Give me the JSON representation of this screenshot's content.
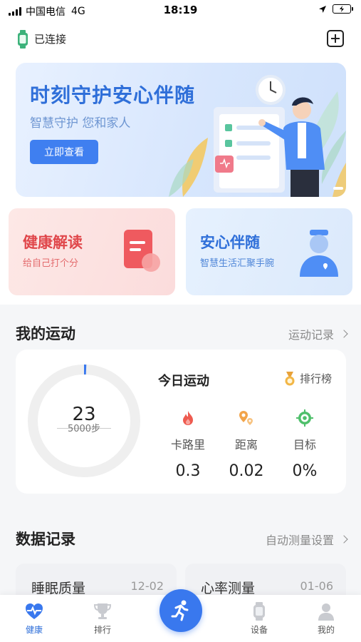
{
  "status_bar": {
    "carrier": "中国电信",
    "network": "4G",
    "time": "18:19"
  },
  "header": {
    "connection_status": "已连接"
  },
  "banner": {
    "title": "时刻守护安心伴随",
    "subtitle": "智慧守护 您和家人",
    "button_label": "立即查看"
  },
  "cards": [
    {
      "title": "健康解读",
      "subtitle": "给自己打个分"
    },
    {
      "title": "安心伴随",
      "subtitle": "智慧生活汇聚手腕"
    }
  ],
  "exercise": {
    "section_title": "我的运动",
    "link_label": "运动记录",
    "steps": "23",
    "goal": "5000步",
    "progress": 0.0046,
    "today_title": "今日运动",
    "rank_label": "排行榜",
    "metrics": [
      {
        "label": "卡路里",
        "value": "0.3",
        "icon": "flame-icon"
      },
      {
        "label": "距离",
        "value": "0.02",
        "icon": "location-pin-icon"
      },
      {
        "label": "目标",
        "value": "0%",
        "icon": "target-icon"
      }
    ]
  },
  "records": {
    "section_title": "数据记录",
    "link_label": "自动测量设置",
    "items": [
      {
        "title": "睡眠质量",
        "date": "12-02"
      },
      {
        "title": "心率测量",
        "date": "01-06"
      }
    ]
  },
  "tabs": [
    {
      "label": "健康",
      "active": true,
      "icon": "heart-pulse-icon"
    },
    {
      "label": "排行",
      "active": false,
      "icon": "trophy-icon"
    },
    {
      "label": "",
      "active": false,
      "icon": "running-icon"
    },
    {
      "label": "设备",
      "active": false,
      "icon": "watch-icon"
    },
    {
      "label": "我的",
      "active": false,
      "icon": "user-icon"
    }
  ],
  "colors": {
    "accent": "#3978ee",
    "health_red": "#e0474b",
    "safety_blue": "#2f6fd9"
  }
}
